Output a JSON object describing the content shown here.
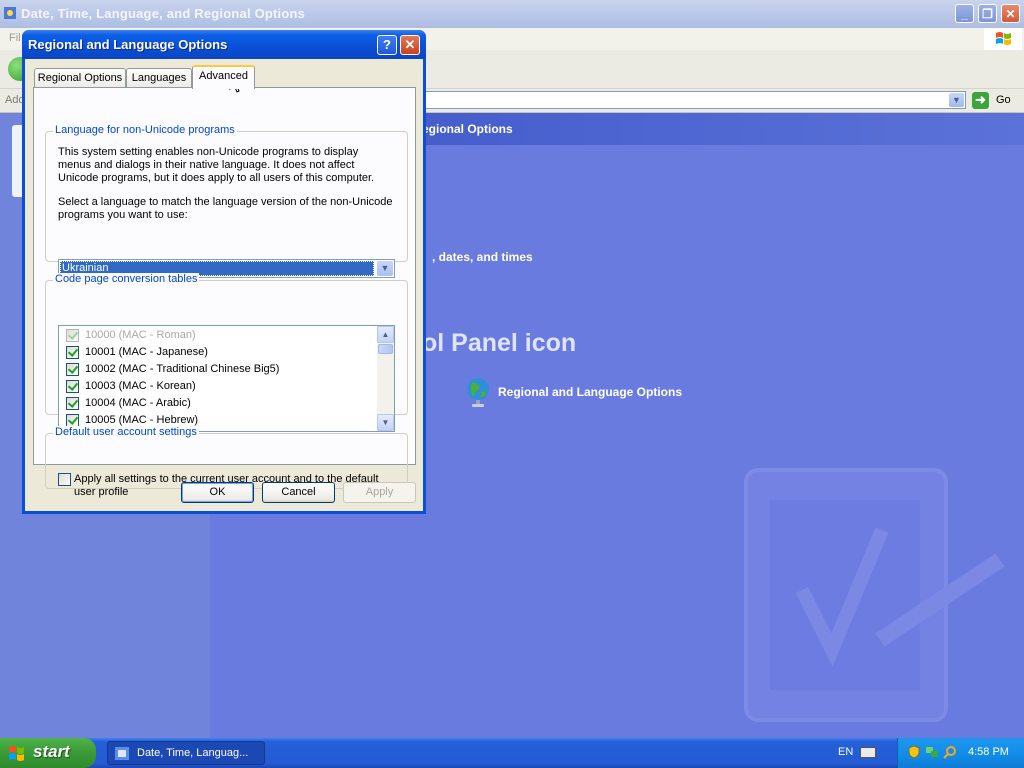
{
  "window": {
    "title": "Date, Time, Language, and Regional Options",
    "menu_file": "Fil",
    "address_label": "Add",
    "go_label": "Go",
    "heading_fragment": "egional Options",
    "task_fragment": ", dates, and times",
    "section_heading_fragment": "ol Panel icon",
    "control_panel_item": "Regional and Language Options"
  },
  "dialog": {
    "title": "Regional and Language Options",
    "help_glyph": "?",
    "close_glyph": "✕",
    "tabs": [
      {
        "label": "Regional Options",
        "active": false
      },
      {
        "label": "Languages",
        "active": false
      },
      {
        "label": "Advanced",
        "active": true
      }
    ],
    "non_unicode": {
      "group_label": "Language for non-Unicode programs",
      "description": "This system setting enables non-Unicode programs to display menus and dialogs in their native language. It does not affect Unicode programs, but it does apply to all users of this computer.",
      "prompt": "Select a language to match the language version of the non-Unicode programs you want to use:",
      "selected_language": "Ukrainian"
    },
    "code_pages": {
      "group_label": "Code page conversion tables",
      "items": [
        {
          "label": "10000 (MAC - Roman)",
          "checked": true,
          "disabled": true
        },
        {
          "label": "10001 (MAC - Japanese)",
          "checked": true,
          "disabled": false
        },
        {
          "label": "10002 (MAC - Traditional Chinese Big5)",
          "checked": true,
          "disabled": false
        },
        {
          "label": "10003 (MAC - Korean)",
          "checked": true,
          "disabled": false
        },
        {
          "label": "10004 (MAC - Arabic)",
          "checked": true,
          "disabled": false
        },
        {
          "label": "10005 (MAC - Hebrew)",
          "checked": true,
          "disabled": false
        }
      ]
    },
    "default_account": {
      "group_label": "Default user account settings",
      "apply_label_line1": "Apply all settings to the current user account and to the default",
      "apply_label_line2": "user profile",
      "checked": false
    },
    "buttons": {
      "ok": "OK",
      "cancel": "Cancel",
      "apply": "Apply"
    }
  },
  "taskbar": {
    "start_label": "start",
    "task_button": "Date, Time, Languag...",
    "language_indicator": "EN",
    "clock": "4:58 PM"
  }
}
